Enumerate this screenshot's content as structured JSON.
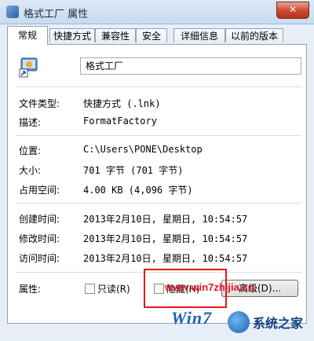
{
  "window": {
    "title": "格式工厂 属性",
    "close_label": "✕"
  },
  "tabs": [
    {
      "label": "常规"
    },
    {
      "label": "快捷方式"
    },
    {
      "label": "兼容性"
    },
    {
      "label": "安全"
    },
    {
      "label": "详细信息"
    },
    {
      "label": "以前的版本"
    }
  ],
  "file": {
    "name": "格式工厂"
  },
  "props": {
    "type": {
      "label": "文件类型:",
      "value": "快捷方式 (.lnk)"
    },
    "desc": {
      "label": "描述:",
      "value": "FormatFactory"
    },
    "location": {
      "label": "位置:",
      "value": "C:\\Users\\PONE\\Desktop"
    },
    "size": {
      "label": "大小:",
      "value": "701 字节 (701 字节)"
    },
    "disk": {
      "label": "占用空间:",
      "value": "4.00 KB (4,096 字节)"
    },
    "created": {
      "label": "创建时间:",
      "value": "2013年2月10日, 星期日, 10:54:57"
    },
    "modified": {
      "label": "修改时间:",
      "value": "2013年2月10日, 星期日, 10:54:57"
    },
    "accessed": {
      "label": "访问时间:",
      "value": "2013年2月10日, 星期日, 10:54:57"
    }
  },
  "attributes": {
    "label": "属性:",
    "readonly": "只读(R)",
    "hidden": "隐藏(H)",
    "advanced": "高级(D)..."
  },
  "watermark": {
    "url": "www.win7zhijia.cn",
    "win": "Win7",
    "brand": "系统之家"
  }
}
